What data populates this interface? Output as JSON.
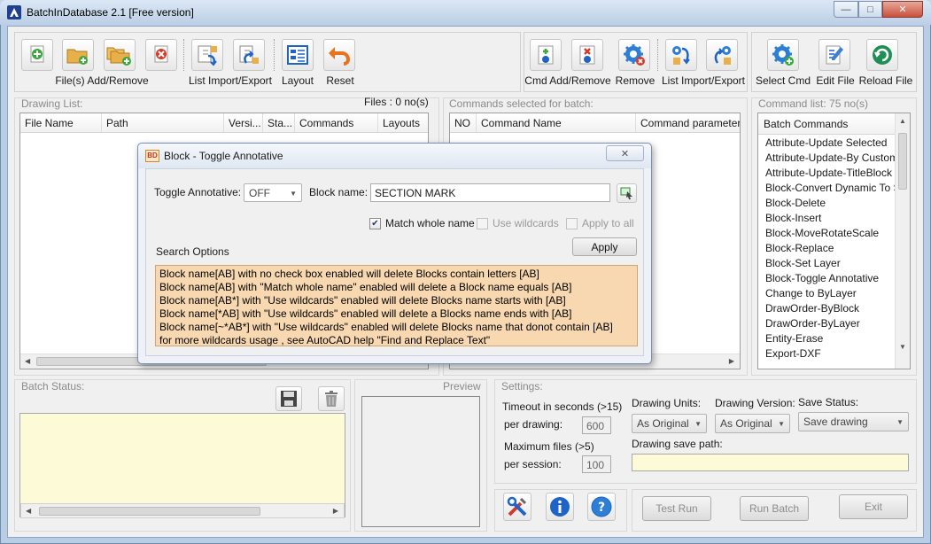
{
  "window": {
    "title": "BatchInDatabase 2.1 [Free version]",
    "min_glyph": "—",
    "max_glyph": "□",
    "close_glyph": "✕"
  },
  "toolbar": {
    "files_label": "File(s) Add/Remove",
    "list_import_export_label": "List Import/Export",
    "layout_label": "Layout",
    "reset_label": "Reset",
    "cmd_add_remove_label": "Cmd Add/Remove",
    "remove_label": "Remove",
    "cmd_list_import_export_label": "List Import/Export",
    "select_cmd_label": "Select Cmd",
    "edit_file_label": "Edit File",
    "reload_file_label": "Reload File"
  },
  "drawing_list": {
    "caption": "Drawing List:",
    "files_count": "Files : 0 no(s)",
    "columns": [
      "File Name",
      "Path",
      "Versi...",
      "Sta...",
      "Commands",
      "Layouts"
    ]
  },
  "commands_selected": {
    "caption": "Commands selected for batch:",
    "columns": [
      "NO",
      "Command Name",
      "Command parameters"
    ]
  },
  "command_list": {
    "caption": "Command list: 75 no(s)",
    "header": "Batch Commands",
    "items": [
      "Attribute-Update Selected",
      "Attribute-Update-By Custom Data",
      "Attribute-Update-TitleBlock",
      "Block-Convert Dynamic To Static",
      "Block-Delete",
      "Block-Insert",
      "Block-MoveRotateScale",
      "Block-Replace",
      "Block-Set Layer",
      "Block-Toggle Annotative",
      "Change to ByLayer",
      "DrawOrder-ByBlock",
      "DrawOrder-ByLayer",
      "Entity-Erase",
      "Export-DXF"
    ]
  },
  "batch_status": {
    "caption": "Batch Status:"
  },
  "preview": {
    "caption": "Preview"
  },
  "settings": {
    "caption": "Settings:",
    "timeout_label": "Timeout in seconds (>15)",
    "per_drawing_label": "per drawing:",
    "per_drawing_value": "600",
    "max_files_label": "Maximum files (>5)",
    "per_session_label": "per session:",
    "per_session_value": "100",
    "drawing_units_label": "Drawing Units:",
    "drawing_units_value": "As Original",
    "drawing_version_label": "Drawing Version:",
    "drawing_version_value": "As Original",
    "save_status_label": "Save Status:",
    "save_status_value": "Save drawing",
    "save_path_label": "Drawing save path:",
    "save_path_value": ""
  },
  "actions": {
    "test_run": "Test Run",
    "run_batch": "Run Batch",
    "exit": "Exit"
  },
  "dialog": {
    "title": "Block - Toggle Annotative",
    "close_glyph": "✕",
    "toggle_label": "Toggle Annotative:",
    "toggle_value": "OFF",
    "block_name_label": "Block name:",
    "block_name_value": "SECTION MARK",
    "match_whole_name_label": "Match whole name",
    "use_wildcards_label": "Use wildcards",
    "apply_to_all_label": "Apply to all",
    "apply_button": "Apply",
    "search_options_label": "Search Options",
    "search_lines": [
      "Block name[AB] with no check box enabled will delete  Blocks contain letters [AB]",
      "Block name[AB] with \"Match whole name\" enabled will delete a Block name equals [AB]",
      "Block name[AB*] with \"Use wildcards\" enabled will delete  Blocks name starts with [AB]",
      "Block name[*AB] with \"Use wildcards\" enabled will delete a Blocks name ends with [AB]",
      "Block name[~*AB*] with \"Use wildcards\" enabled will delete Blocks name that donot contain [AB]",
      "for more wildcards usage , see AutoCAD help  \"Find and Replace Text\""
    ]
  },
  "colors": {
    "search_options_bg": "#f8d8b0",
    "status_panel_bg": "#fdfbd7",
    "accent_blue": "#1e64c8",
    "accent_red": "#d43a2a"
  }
}
